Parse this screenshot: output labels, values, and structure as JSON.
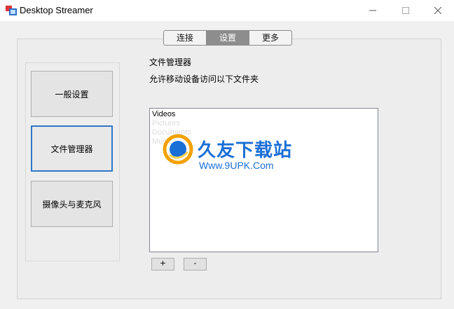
{
  "window": {
    "title": "Desktop Streamer",
    "controls": {
      "minimize": "—",
      "maximize": "☐",
      "close": "✕"
    }
  },
  "tabs": [
    {
      "label": "连接",
      "active": false
    },
    {
      "label": "设置",
      "active": true
    },
    {
      "label": "更多",
      "active": false
    }
  ],
  "sidebar": {
    "items": [
      {
        "label": "一般设置",
        "selected": false
      },
      {
        "label": "文件管理器",
        "selected": true
      },
      {
        "label": "摄像头与麦克风",
        "selected": false
      }
    ]
  },
  "main": {
    "section_title": "文件管理器",
    "description": "允许移动设备访问以下文件夹",
    "folders": [
      "Videos",
      "Pictures",
      "Documents",
      "Music"
    ],
    "add_label": "+",
    "remove_label": "-"
  },
  "watermark": {
    "title": "久友下载站",
    "url": "Www.9UPK.Com"
  },
  "colors": {
    "accent": "#2f76c7",
    "active_tab": "#8d8d8d",
    "watermark": "#1a6fd6"
  }
}
